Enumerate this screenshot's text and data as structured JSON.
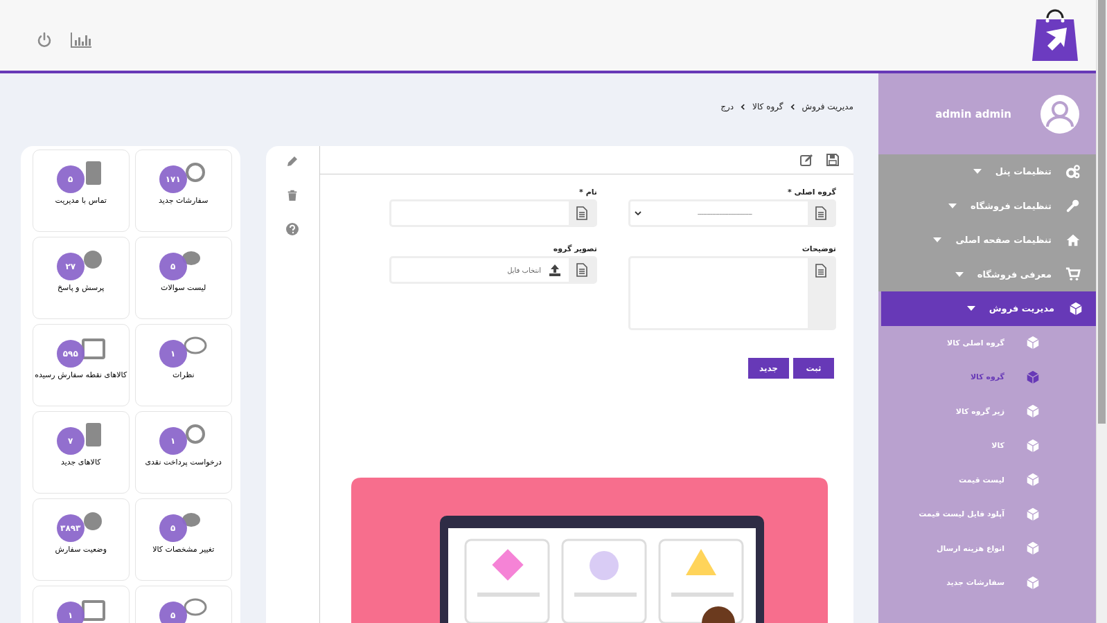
{
  "breadcrumb": [
    "مدیریت فروش",
    "گروه کالا",
    "درج"
  ],
  "user": {
    "name": "admin admin"
  },
  "menu": [
    {
      "label": "تنظیمات پنل",
      "selected": false
    },
    {
      "label": "تنظیمات فروشگاه",
      "selected": false
    },
    {
      "label": "تنظیمات صفحه اصلی",
      "selected": false
    },
    {
      "label": "معرفی فروشگاه",
      "selected": false
    },
    {
      "label": "مدیریت فروش",
      "selected": true,
      "children": [
        {
          "label": "گروه اصلی کالا",
          "selected": false
        },
        {
          "label": "گروه کالا",
          "selected": true
        },
        {
          "label": "زیر گروه کالا",
          "selected": false
        },
        {
          "label": "کالا",
          "selected": false
        },
        {
          "label": "لیست قیمت",
          "selected": false
        },
        {
          "label": "آپلود فایل لیست قیمت",
          "selected": false
        },
        {
          "label": "انواع هزینه ارسال",
          "selected": false
        },
        {
          "label": "سفارشات جدید",
          "selected": false
        }
      ]
    }
  ],
  "form": {
    "fields": [
      {
        "label": "گروه اصلی *",
        "kind": "select",
        "value": "------------------------------"
      },
      {
        "label": "نام *",
        "kind": "text"
      },
      {
        "label": "توضیحات",
        "kind": "textarea"
      },
      {
        "label": "تصویر گروه",
        "kind": "file",
        "placeholder": "انتخاب فایل"
      }
    ],
    "buttons": [
      "ثبت",
      "جدید"
    ]
  },
  "tiles": [
    {
      "label": "سفارشات جدید",
      "count": "۱۷۱"
    },
    {
      "label": "تماس با مدیریت",
      "count": "۵"
    },
    {
      "label": "لیست سوالات",
      "count": "۵"
    },
    {
      "label": "پرسش و پاسخ",
      "count": "۲۷"
    },
    {
      "label": "نظرات",
      "count": "۱"
    },
    {
      "label": "کالاهای نقطه سفارش رسیده",
      "count": "۵۹۵"
    },
    {
      "label": "درخواست پرداخت نقدی",
      "count": "۱"
    },
    {
      "label": "کالاهای جدید",
      "count": "۷"
    },
    {
      "label": "تغییر مشخصات کالا",
      "count": "۵"
    },
    {
      "label": "وضعیت سفارش",
      "count": "۳۸۹۳"
    },
    {
      "count": "۵"
    },
    {
      "count": "۱"
    }
  ]
}
